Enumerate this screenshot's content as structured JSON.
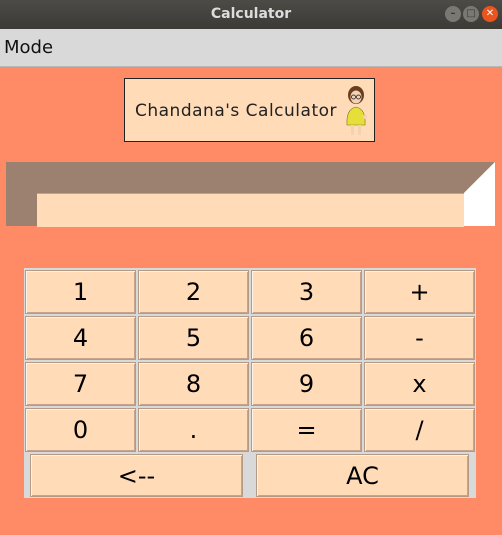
{
  "window": {
    "title": "Calculator",
    "controls": [
      "minimize",
      "maximize",
      "close"
    ]
  },
  "menubar": {
    "mode_label": "Mode"
  },
  "logo": {
    "text": "Chandana's Calculator"
  },
  "display": {
    "value": ""
  },
  "keypad": {
    "rows": [
      [
        "1",
        "2",
        "3",
        "+"
      ],
      [
        "4",
        "5",
        "6",
        "-"
      ],
      [
        "7",
        "8",
        "9",
        "x"
      ],
      [
        "0",
        ".",
        "=",
        "/"
      ]
    ],
    "backspace_label": "<--",
    "clear_label": "AC"
  },
  "colors": {
    "background": "#ff8a66",
    "button_face": "#ffdbb8",
    "bevel_dark": "#9c8170",
    "bevel_light": "#ffffff",
    "menubar": "#d9d9d9"
  }
}
